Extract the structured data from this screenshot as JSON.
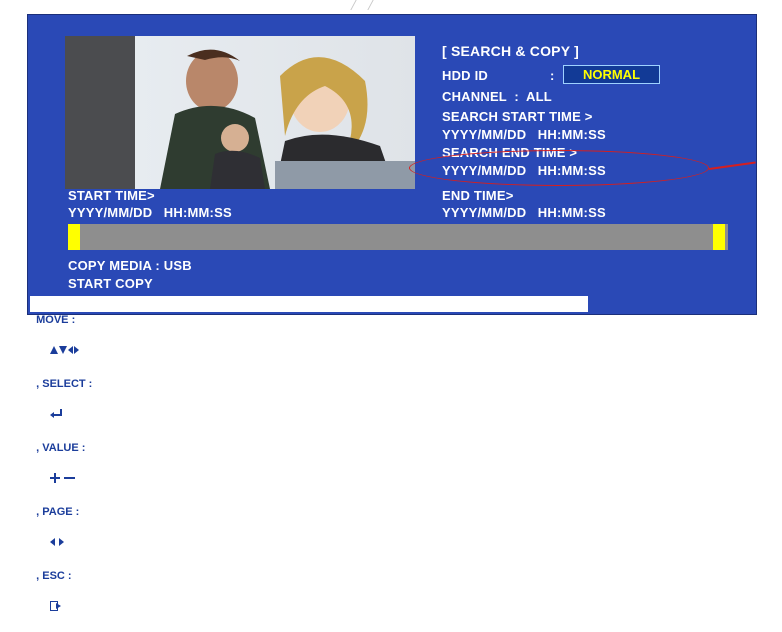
{
  "panel": {
    "title": "[ SEARCH & COPY ]",
    "hdd_id_label": "HDD ID",
    "hdd_id_colon": ":",
    "hdd_id_value": "NORMAL",
    "channel_line": "CHANNEL  :  ALL",
    "search_start_label": "SEARCH START TIME >",
    "search_start_value": "YYYY/MM/DD   HH:MM:SS",
    "search_end_label": "SEARCH END TIME >",
    "search_end_value": "YYYY/MM/DD   HH:MM:SS"
  },
  "times": {
    "start_label": "START TIME>",
    "start_value": "YYYY/MM/DD   HH:MM:SS",
    "end_label": "END TIME>",
    "end_value": "YYYY/MM/DD   HH:MM:SS"
  },
  "copy": {
    "media_line": "COPY MEDIA : USB",
    "start_copy": "START COPY"
  },
  "footer": {
    "move_label": "MOVE :",
    "select_label": ", SELECT :",
    "value_label": ", VALUE :",
    "page_label": ", PAGE :",
    "esc_label": ", ESC :"
  },
  "colors": {
    "screen_bg": "#2a49b6",
    "highlight": "#ffff00",
    "annotation": "#d51f1f",
    "footer_text": "#1b3d9b"
  },
  "icons": [
    "arrow-keys-icon",
    "enter-icon",
    "plus-minus-icon",
    "left-right-icon",
    "exit-icon",
    "family-photo-image"
  ]
}
